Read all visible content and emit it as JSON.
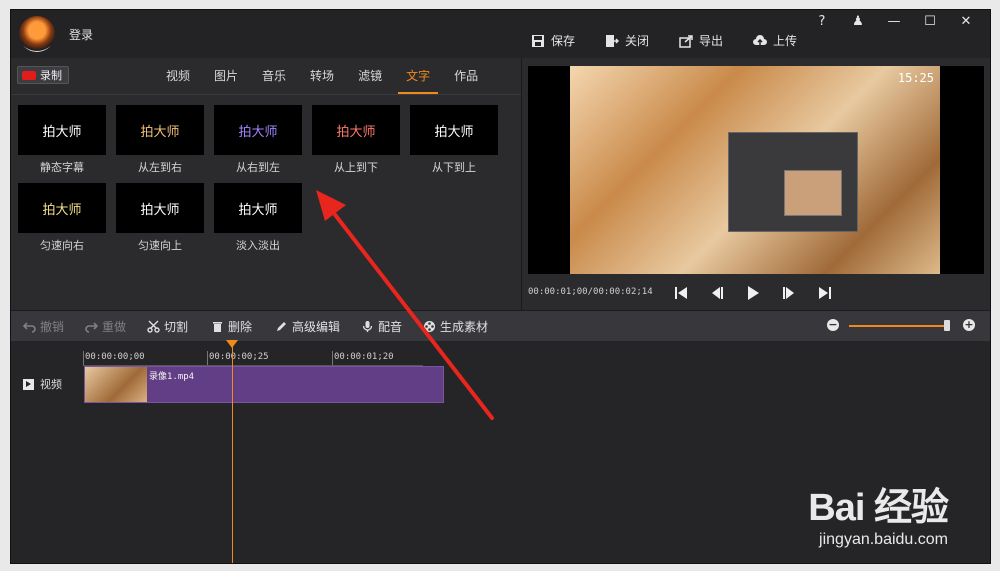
{
  "header": {
    "login_label": "登录",
    "window_controls": [
      "?",
      "♟",
      "—",
      "☐",
      "✕"
    ]
  },
  "top_actions": [
    {
      "label": "保存",
      "icon": "save-icon"
    },
    {
      "label": "关闭",
      "icon": "close-file-icon"
    },
    {
      "label": "导出",
      "icon": "export-icon"
    },
    {
      "label": "上传",
      "icon": "upload-icon"
    }
  ],
  "left_panel": {
    "record_label": "录制",
    "tabs": [
      "视频",
      "图片",
      "音乐",
      "转场",
      "滤镜",
      "文字",
      "作品"
    ],
    "active_tab": "文字",
    "effects": [
      {
        "thumb_text": "拍大师",
        "label": "静态字幕",
        "color": "#ffffff"
      },
      {
        "thumb_text": "拍大师",
        "label": "从左到右",
        "color": "#f4c27a"
      },
      {
        "thumb_text": "拍大师",
        "label": "从右到左",
        "color": "#9f86ff"
      },
      {
        "thumb_text": "拍大师",
        "label": "从上到下",
        "color": "#ff7a6a"
      },
      {
        "thumb_text": "拍大师",
        "label": "从下到上",
        "color": "#ffffff"
      },
      {
        "thumb_text": "拍大师",
        "label": "匀速向右",
        "color": "#f4e08a"
      },
      {
        "thumb_text": "拍大师",
        "label": "匀速向上",
        "color": "#ffffff"
      },
      {
        "thumb_text": "拍大师",
        "label": "淡入淡出",
        "color": "#ffffff"
      }
    ]
  },
  "preview": {
    "clock": "15:25",
    "time_readout": "00:00:01;00/00:00:02;14",
    "controls": [
      "skip-back-icon",
      "step-back-icon",
      "play-icon",
      "step-forward-icon",
      "skip-forward-icon"
    ]
  },
  "toolbar": {
    "undo": "撤销",
    "redo": "重做",
    "cut": "切割",
    "delete": "删除",
    "advanced_edit": "高级编辑",
    "dub": "配音",
    "generate": "生成素材"
  },
  "timeline": {
    "ticks": [
      "00:00:00;00",
      "00:00:00;25",
      "00:00:01;20"
    ],
    "track_label": "视频",
    "clip_name": "录像1.mp4"
  },
  "watermark": {
    "logo": "Bai 经验",
    "url": "jingyan.baidu.com"
  },
  "colors": {
    "accent": "#f08a1c",
    "clip": "#613e85",
    "background": "#2b2b2e"
  }
}
